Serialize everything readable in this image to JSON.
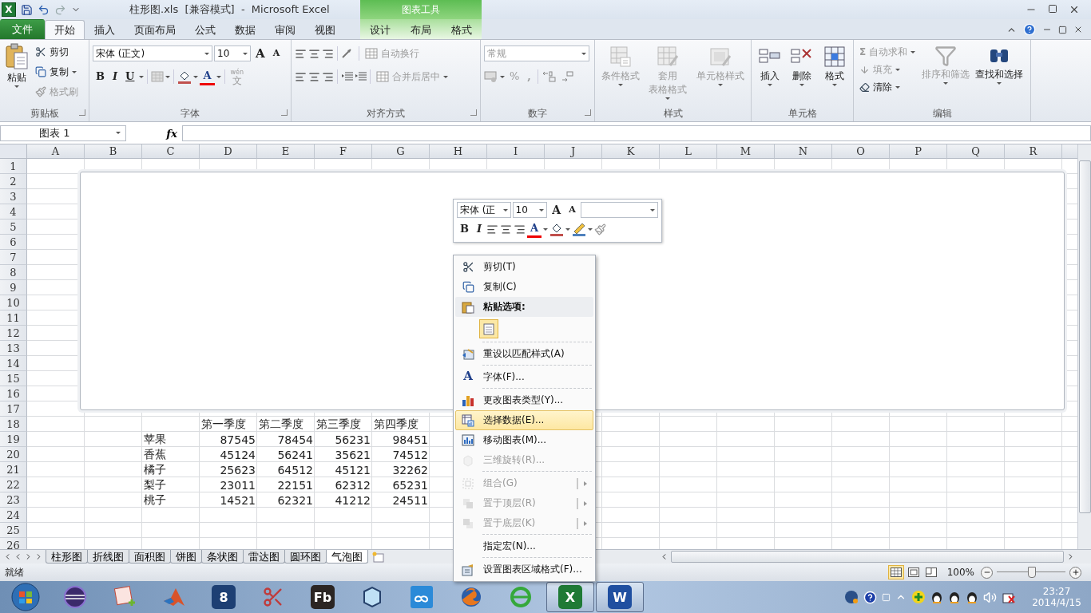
{
  "title_bar": {
    "app_glyph": "X",
    "title": "柱形图.xls  [兼容模式]  -  Microsoft Excel",
    "context_label": "图表工具"
  },
  "tabs": [
    {
      "label": "文件",
      "kind": "file",
      "selected": false
    },
    {
      "label": "开始",
      "kind": "main",
      "selected": true
    },
    {
      "label": "插入",
      "kind": "main",
      "selected": false
    },
    {
      "label": "页面布局",
      "kind": "main",
      "selected": false
    },
    {
      "label": "公式",
      "kind": "main",
      "selected": false
    },
    {
      "label": "数据",
      "kind": "main",
      "selected": false
    },
    {
      "label": "审阅",
      "kind": "main",
      "selected": false
    },
    {
      "label": "视图",
      "kind": "main",
      "selected": false
    },
    {
      "label": "设计",
      "kind": "context",
      "selected": false
    },
    {
      "label": "布局",
      "kind": "context",
      "selected": false
    },
    {
      "label": "格式",
      "kind": "context",
      "selected": false
    }
  ],
  "ribbon": {
    "clipboard": {
      "title": "剪贴板",
      "paste": {
        "label": "粘贴"
      },
      "cut": {
        "label": "剪切",
        "disabled": false
      },
      "copy": {
        "label": "复制",
        "disabled": false
      },
      "format_painter": {
        "label": "格式刷",
        "disabled": true
      }
    },
    "font": {
      "title": "字体",
      "font_name": "宋体 (正文)",
      "font_size": "10",
      "grow": "A",
      "shrink": "A",
      "bold": "B",
      "italic": "I",
      "underline": "U",
      "font_color": "A",
      "border_disabled": true,
      "phonetic": {
        "top": "wén",
        "bottom": "文",
        "disabled": true
      }
    },
    "alignment": {
      "title": "对齐方式",
      "wrap": {
        "label": "自动换行",
        "disabled": true
      },
      "merge": {
        "label": "合并后居中",
        "disabled": true
      }
    },
    "number": {
      "title": "数字",
      "format": "常规",
      "percent": "%",
      "comma": ",",
      "disabled": true
    },
    "styles": {
      "title": "样式",
      "buttons": [
        {
          "lines": [
            "条件格式"
          ],
          "kind": "conditional",
          "disabled": true
        },
        {
          "lines": [
            "套用",
            "表格格式"
          ],
          "kind": "table",
          "disabled": true
        },
        {
          "lines": [
            "单元格样式"
          ],
          "kind": "cellstyle",
          "disabled": true
        }
      ]
    },
    "cells": {
      "title": "单元格",
      "buttons": [
        {
          "lines": [
            "插入"
          ],
          "kind": "insert",
          "disabled": false
        },
        {
          "lines": [
            "删除"
          ],
          "kind": "delete",
          "disabled": false
        },
        {
          "lines": [
            "格式"
          ],
          "kind": "format",
          "disabled": false
        }
      ]
    },
    "editing": {
      "title": "编辑",
      "autosum": {
        "glyph": "Σ",
        "label": "自动求和",
        "disabled": true
      },
      "fill": {
        "label": "填充",
        "disabled": true
      },
      "clear": {
        "label": "清除",
        "disabled": false
      },
      "sort": {
        "label": "排序和筛选",
        "disabled": true
      },
      "find": {
        "label": "查找和选择",
        "disabled": false
      }
    }
  },
  "formula_bar": {
    "name_box": "图表 1",
    "fx": "fx"
  },
  "sheet": {
    "columns": [
      "A",
      "B",
      "C",
      "D",
      "E",
      "F",
      "G",
      "H",
      "I",
      "J",
      "K",
      "L",
      "M",
      "N",
      "O",
      "P",
      "Q",
      "R"
    ],
    "rows": [
      "1",
      "2",
      "3",
      "4",
      "5",
      "6",
      "7",
      "8",
      "9",
      "10",
      "11",
      "12",
      "13",
      "14",
      "15",
      "16",
      "17",
      "18",
      "19",
      "20",
      "21",
      "22",
      "23",
      "24",
      "25",
      "26"
    ],
    "table": {
      "header": [
        "第一季度",
        "第二季度",
        "第三季度",
        "第四季度"
      ],
      "rows": [
        {
          "name": "苹果",
          "values": [
            "87545",
            "78454",
            "56231",
            "98451"
          ]
        },
        {
          "name": "香蕉",
          "values": [
            "45124",
            "56241",
            "35621",
            "74512"
          ]
        },
        {
          "name": "橘子",
          "values": [
            "25623",
            "64512",
            "45121",
            "32262"
          ]
        },
        {
          "name": "梨子",
          "values": [
            "23011",
            "22151",
            "62312",
            "65231"
          ]
        },
        {
          "name": "桃子",
          "values": [
            "14521",
            "62321",
            "41212",
            "24511"
          ]
        }
      ]
    }
  },
  "mini_toolbar": {
    "font_name": "宋体 (正",
    "font_size": "10",
    "grow": "A",
    "shrink": "A",
    "bold": "B",
    "italic": "I",
    "font_color": "A"
  },
  "context_menu": [
    {
      "kind": "cut",
      "label": "剪切(T)",
      "disabled": false,
      "selected": false,
      "submenu": false,
      "separator_before": false
    },
    {
      "kind": "copy",
      "label": "复制(C)",
      "disabled": false,
      "selected": false,
      "submenu": false,
      "separator_before": false
    },
    {
      "kind": "header",
      "label": "粘贴选项:"
    },
    {
      "kind": "paste"
    },
    {
      "kind": "reset",
      "label": "重设以匹配样式(A)",
      "disabled": false,
      "selected": false,
      "submenu": false,
      "separator_before": true
    },
    {
      "kind": "font",
      "glyph": "A",
      "label": "字体(F)...",
      "disabled": false,
      "selected": false,
      "submenu": false,
      "separator_before": true
    },
    {
      "kind": "charttype",
      "label": "更改图表类型(Y)...",
      "disabled": false,
      "selected": false,
      "submenu": false,
      "separator_before": true
    },
    {
      "kind": "selectdata",
      "label": "选择数据(E)...",
      "disabled": false,
      "selected": true,
      "submenu": false,
      "separator_before": false
    },
    {
      "kind": "move",
      "label": "移动图表(M)...",
      "disabled": false,
      "selected": false,
      "submenu": false,
      "separator_before": false
    },
    {
      "kind": "rotate",
      "label": "三维旋转(R)...",
      "disabled": true,
      "selected": false,
      "submenu": false,
      "separator_before": false
    },
    {
      "kind": "group",
      "label": "组合(G)",
      "disabled": true,
      "selected": false,
      "submenu": true,
      "separator_before": true
    },
    {
      "kind": "front",
      "label": "置于顶层(R)",
      "disabled": true,
      "selected": false,
      "submenu": true,
      "separator_before": false
    },
    {
      "kind": "back",
      "label": "置于底层(K)",
      "disabled": true,
      "selected": false,
      "submenu": true,
      "separator_before": false
    },
    {
      "kind": "macro",
      "label": "指定宏(N)...",
      "disabled": false,
      "selected": false,
      "submenu": false,
      "separator_before": true
    },
    {
      "kind": "format",
      "label": "设置图表区域格式(F)...",
      "disabled": false,
      "selected": false,
      "submenu": false,
      "separator_before": true
    }
  ],
  "sheet_tabs": [
    {
      "label": "柱形图",
      "selected": false
    },
    {
      "label": "折线图",
      "selected": false
    },
    {
      "label": "面积图",
      "selected": false
    },
    {
      "label": "饼图",
      "selected": false
    },
    {
      "label": "条状图",
      "selected": false
    },
    {
      "label": "雷达图",
      "selected": false
    },
    {
      "label": "圆环图",
      "selected": false
    },
    {
      "label": "气泡图",
      "selected": true
    }
  ],
  "status_bar": {
    "text": "就绪",
    "views": [
      {
        "kind": "normal",
        "selected": true
      },
      {
        "kind": "layout",
        "selected": false
      },
      {
        "kind": "pagebreak",
        "selected": false
      }
    ],
    "zoom": "100%",
    "zoom_slider": {
      "level": 0.5
    }
  },
  "taskbar": {
    "apps": [
      {
        "kind": "start",
        "active": false
      },
      {
        "kind": "sphere",
        "active": false
      },
      {
        "kind": "notepad",
        "active": false
      },
      {
        "kind": "peak",
        "active": false
      },
      {
        "kind": "glyph",
        "glyph": "8",
        "color": "#1d3f73",
        "active": false
      },
      {
        "kind": "scissors",
        "active": false
      },
      {
        "kind": "glyph",
        "glyph": "Fb",
        "color": "#2b2523",
        "active": false
      },
      {
        "kind": "cube",
        "active": false
      },
      {
        "kind": "cloud",
        "active": false
      },
      {
        "kind": "fox",
        "active": false
      },
      {
        "kind": "browser",
        "active": false
      },
      {
        "kind": "glyph",
        "glyph": "X",
        "color": "#1f7a35",
        "active": true
      },
      {
        "kind": "glyph",
        "glyph": "W",
        "color": "#1f4fa0",
        "active": true
      }
    ],
    "clock": {
      "time": "23:27",
      "date": "2014/4/15"
    }
  }
}
